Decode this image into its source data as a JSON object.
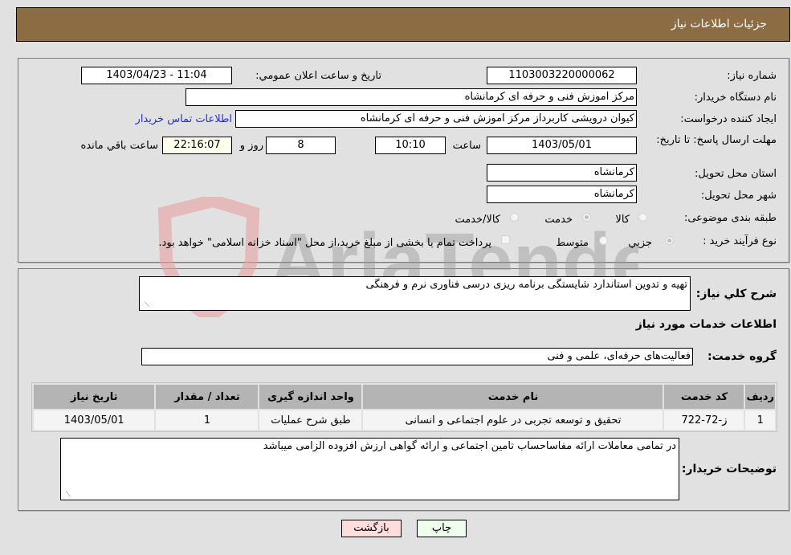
{
  "header": {
    "title": "جزئیات اطلاعات نیاز"
  },
  "form": {
    "need_number": {
      "label": "شماره نیاز:",
      "value": "1103003220000062"
    },
    "announce_datetime": {
      "label": "تاریخ و ساعت اعلان عمومي:",
      "value": "1403/04/23 - 11:04"
    },
    "buyer_org": {
      "label": "نام دستگاه خریدار:",
      "value": "مرکز اموزش فنی و حرفه ای کرمانشاه"
    },
    "requester": {
      "label": "ایجاد کننده درخواست:",
      "value": "کیوان درویشی کاربرداز مرکز اموزش فنی و حرفه ای کرمانشاه"
    },
    "buyer_contact_link": "اطلاعات تماس خریدار",
    "deadline": {
      "label": "مهلت ارسال پاسخ: تا تاریخ:",
      "date": "1403/05/01",
      "time_label": "ساعت",
      "time": "10:10",
      "days": "8",
      "days_label": "روز و",
      "remaining": "22:16:07",
      "remaining_label": "ساعت باقي مانده"
    },
    "province": {
      "label": "استان محل تحویل:",
      "value": "کرمانشاه"
    },
    "city": {
      "label": "شهر محل تحویل:",
      "value": "کرمانشاه"
    },
    "category": {
      "label": "طبقه بندی موضوعی:",
      "options": [
        {
          "label": "کالا",
          "selected": false
        },
        {
          "label": "خدمت",
          "selected": true
        },
        {
          "label": "کالا/خدمت",
          "selected": false
        }
      ]
    },
    "purchase_type": {
      "label": "نوع فرآیند خرید :",
      "options": [
        {
          "label": "جزيي",
          "selected": true
        },
        {
          "label": "متوسط",
          "selected": false
        }
      ],
      "treasury_checkbox": {
        "label": "پرداخت تمام یا بخشی از مبلغ خرید،از محل \"اسناد خزانه اسلامی\" خواهد بود.",
        "checked": false
      }
    }
  },
  "details": {
    "summary_label": "شرح کلي نیاز:",
    "summary_value": "تهیه و تدوین استاندارد شایستگی برنامه ریزی درسی فناوری نرم و فرهنگی",
    "services_heading": "اطلاعات خدمات مورد نیاز",
    "service_group_label": "گروه خدمت:",
    "service_group_value": "فعالیت‌های حرفه‌ای، علمی و فنی",
    "table": {
      "headers": [
        "ردیف",
        "کد خدمت",
        "نام خدمت",
        "واحد اندازه گیری",
        "تعداد / مقدار",
        "تاریخ نیاز"
      ],
      "rows": [
        [
          "1",
          "ز-72-722",
          "تحقیق و توسعه تجربی در علوم اجتماعی و انسانی",
          "طبق شرح عملیات",
          "1",
          "1403/05/01"
        ]
      ]
    },
    "buyer_notes_label": "توضیحات خریدار:",
    "buyer_notes_value": "در تمامی معاملات ارائه مفاساحساب تامین اجتماعی و ارائه گواهی ارزش افزوده الزامی میباشد"
  },
  "buttons": {
    "print": "چاپ",
    "back": "بازگشت"
  },
  "watermark": {
    "text": "AriaTender.neT"
  },
  "colors": {
    "header_bg": "#8c6c43",
    "print_bg": "#eeffee",
    "back_bg": "#ffdddd",
    "link": "#2a2ae0"
  }
}
